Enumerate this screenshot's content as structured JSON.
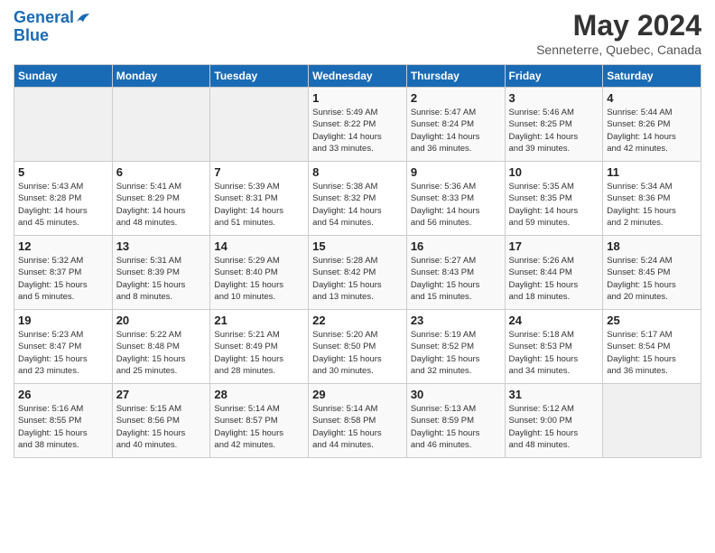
{
  "header": {
    "logo_line1": "General",
    "logo_line2": "Blue",
    "title": "May 2024",
    "subtitle": "Senneterre, Quebec, Canada"
  },
  "days_of_week": [
    "Sunday",
    "Monday",
    "Tuesday",
    "Wednesday",
    "Thursday",
    "Friday",
    "Saturday"
  ],
  "weeks": [
    [
      {
        "day": "",
        "info": ""
      },
      {
        "day": "",
        "info": ""
      },
      {
        "day": "",
        "info": ""
      },
      {
        "day": "1",
        "info": "Sunrise: 5:49 AM\nSunset: 8:22 PM\nDaylight: 14 hours\nand 33 minutes."
      },
      {
        "day": "2",
        "info": "Sunrise: 5:47 AM\nSunset: 8:24 PM\nDaylight: 14 hours\nand 36 minutes."
      },
      {
        "day": "3",
        "info": "Sunrise: 5:46 AM\nSunset: 8:25 PM\nDaylight: 14 hours\nand 39 minutes."
      },
      {
        "day": "4",
        "info": "Sunrise: 5:44 AM\nSunset: 8:26 PM\nDaylight: 14 hours\nand 42 minutes."
      }
    ],
    [
      {
        "day": "5",
        "info": "Sunrise: 5:43 AM\nSunset: 8:28 PM\nDaylight: 14 hours\nand 45 minutes."
      },
      {
        "day": "6",
        "info": "Sunrise: 5:41 AM\nSunset: 8:29 PM\nDaylight: 14 hours\nand 48 minutes."
      },
      {
        "day": "7",
        "info": "Sunrise: 5:39 AM\nSunset: 8:31 PM\nDaylight: 14 hours\nand 51 minutes."
      },
      {
        "day": "8",
        "info": "Sunrise: 5:38 AM\nSunset: 8:32 PM\nDaylight: 14 hours\nand 54 minutes."
      },
      {
        "day": "9",
        "info": "Sunrise: 5:36 AM\nSunset: 8:33 PM\nDaylight: 14 hours\nand 56 minutes."
      },
      {
        "day": "10",
        "info": "Sunrise: 5:35 AM\nSunset: 8:35 PM\nDaylight: 14 hours\nand 59 minutes."
      },
      {
        "day": "11",
        "info": "Sunrise: 5:34 AM\nSunset: 8:36 PM\nDaylight: 15 hours\nand 2 minutes."
      }
    ],
    [
      {
        "day": "12",
        "info": "Sunrise: 5:32 AM\nSunset: 8:37 PM\nDaylight: 15 hours\nand 5 minutes."
      },
      {
        "day": "13",
        "info": "Sunrise: 5:31 AM\nSunset: 8:39 PM\nDaylight: 15 hours\nand 8 minutes."
      },
      {
        "day": "14",
        "info": "Sunrise: 5:29 AM\nSunset: 8:40 PM\nDaylight: 15 hours\nand 10 minutes."
      },
      {
        "day": "15",
        "info": "Sunrise: 5:28 AM\nSunset: 8:42 PM\nDaylight: 15 hours\nand 13 minutes."
      },
      {
        "day": "16",
        "info": "Sunrise: 5:27 AM\nSunset: 8:43 PM\nDaylight: 15 hours\nand 15 minutes."
      },
      {
        "day": "17",
        "info": "Sunrise: 5:26 AM\nSunset: 8:44 PM\nDaylight: 15 hours\nand 18 minutes."
      },
      {
        "day": "18",
        "info": "Sunrise: 5:24 AM\nSunset: 8:45 PM\nDaylight: 15 hours\nand 20 minutes."
      }
    ],
    [
      {
        "day": "19",
        "info": "Sunrise: 5:23 AM\nSunset: 8:47 PM\nDaylight: 15 hours\nand 23 minutes."
      },
      {
        "day": "20",
        "info": "Sunrise: 5:22 AM\nSunset: 8:48 PM\nDaylight: 15 hours\nand 25 minutes."
      },
      {
        "day": "21",
        "info": "Sunrise: 5:21 AM\nSunset: 8:49 PM\nDaylight: 15 hours\nand 28 minutes."
      },
      {
        "day": "22",
        "info": "Sunrise: 5:20 AM\nSunset: 8:50 PM\nDaylight: 15 hours\nand 30 minutes."
      },
      {
        "day": "23",
        "info": "Sunrise: 5:19 AM\nSunset: 8:52 PM\nDaylight: 15 hours\nand 32 minutes."
      },
      {
        "day": "24",
        "info": "Sunrise: 5:18 AM\nSunset: 8:53 PM\nDaylight: 15 hours\nand 34 minutes."
      },
      {
        "day": "25",
        "info": "Sunrise: 5:17 AM\nSunset: 8:54 PM\nDaylight: 15 hours\nand 36 minutes."
      }
    ],
    [
      {
        "day": "26",
        "info": "Sunrise: 5:16 AM\nSunset: 8:55 PM\nDaylight: 15 hours\nand 38 minutes."
      },
      {
        "day": "27",
        "info": "Sunrise: 5:15 AM\nSunset: 8:56 PM\nDaylight: 15 hours\nand 40 minutes."
      },
      {
        "day": "28",
        "info": "Sunrise: 5:14 AM\nSunset: 8:57 PM\nDaylight: 15 hours\nand 42 minutes."
      },
      {
        "day": "29",
        "info": "Sunrise: 5:14 AM\nSunset: 8:58 PM\nDaylight: 15 hours\nand 44 minutes."
      },
      {
        "day": "30",
        "info": "Sunrise: 5:13 AM\nSunset: 8:59 PM\nDaylight: 15 hours\nand 46 minutes."
      },
      {
        "day": "31",
        "info": "Sunrise: 5:12 AM\nSunset: 9:00 PM\nDaylight: 15 hours\nand 48 minutes."
      },
      {
        "day": "",
        "info": ""
      }
    ]
  ]
}
